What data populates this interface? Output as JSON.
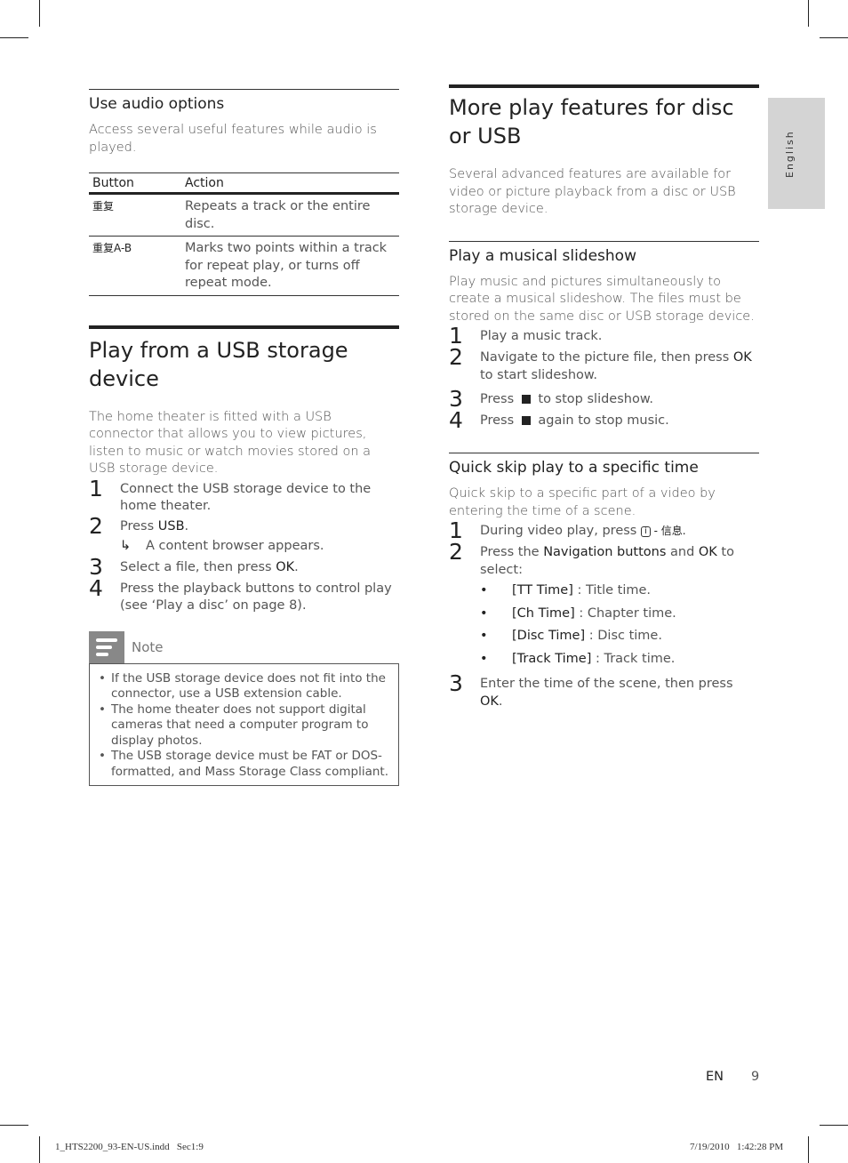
{
  "side_tab": {
    "label": "English"
  },
  "left_column": {
    "audio_options": {
      "title": "Use audio options",
      "intro": "Access several useful features while audio is played.",
      "table": {
        "headers": [
          "Button",
          "Action"
        ],
        "rows": [
          {
            "button": "重复",
            "action": "Repeats a track or the entire disc."
          },
          {
            "button": "重复A-B",
            "action": "Marks two points within a track for repeat play, or turns off repeat mode."
          }
        ]
      }
    },
    "usb_section": {
      "title": "Play from a USB storage device",
      "intro": "The home theater is fitted with a USB connector that allows you to view pictures, listen to music or watch movies stored on a USB storage device.",
      "steps": [
        {
          "num": "1",
          "text": "Connect the USB storage device to the home theater."
        },
        {
          "num": "2",
          "pre": "Press ",
          "bold": "USB",
          "post": ".",
          "result": "A content browser appears."
        },
        {
          "num": "3",
          "pre": "Select a file, then press ",
          "bold": "OK",
          "post": "."
        },
        {
          "num": "4",
          "text": "Press the playback buttons to control play (see ‘Play a disc’ on page 8)."
        }
      ],
      "note": {
        "label": "Note",
        "items": [
          "If the USB storage device does not fit into the connector, use a USB extension cable.",
          "The home theater does not support digital cameras that need a computer program to display photos.",
          "The USB storage device must be FAT or DOS-formatted, and Mass Storage Class compliant."
        ]
      }
    }
  },
  "right_column": {
    "title": "More play features for disc or USB",
    "intro": "Several advanced features are available for video or picture playback from a disc or USB storage device.",
    "slideshow": {
      "title": "Play a musical slideshow",
      "intro": "Play music and pictures simultaneously to create a musical slideshow. The files must be stored on the same disc or USB storage device.",
      "steps": [
        {
          "num": "1",
          "text": "Play a music track."
        },
        {
          "num": "2",
          "pre": "Navigate to the picture file, then press ",
          "bold": "OK",
          "post": " to start slideshow."
        },
        {
          "num": "3",
          "pre": "Press ",
          "post": " to stop slideshow.",
          "icon": "stop-icon"
        },
        {
          "num": "4",
          "pre": "Press ",
          "post": " again to stop music.",
          "icon": "stop-icon"
        }
      ]
    },
    "quick_skip": {
      "title": "Quick skip play to a specific time",
      "intro": "Quick skip to a specific part of a video by entering the time of a scene.",
      "step1": {
        "num": "1",
        "pre": "During video play, press ",
        "icon_glyph": "i",
        "post": " - 信息."
      },
      "step2": {
        "num": "2",
        "pre": "Press the ",
        "bold1": "Navigation buttons",
        "mid": " and ",
        "bold2": "OK",
        "post": " to select:",
        "options": [
          {
            "name": "[TT Time]",
            "desc": " : Title time."
          },
          {
            "name": "[Ch Time]",
            "desc": " : Chapter time."
          },
          {
            "name": "[Disc Time]",
            "desc": " : Disc time."
          },
          {
            "name": "[Track Time]",
            "desc": " : Track time."
          }
        ]
      },
      "step3": {
        "num": "3",
        "pre": "Enter the time of the scene, then press ",
        "bold": "OK",
        "post": "."
      }
    }
  },
  "footer": {
    "lang": "EN",
    "page": "9",
    "slug_left": "1_HTS2200_93-EN-US.indd   Sec1:9",
    "slug_right": "7/19/2010   1:42:28 PM"
  }
}
